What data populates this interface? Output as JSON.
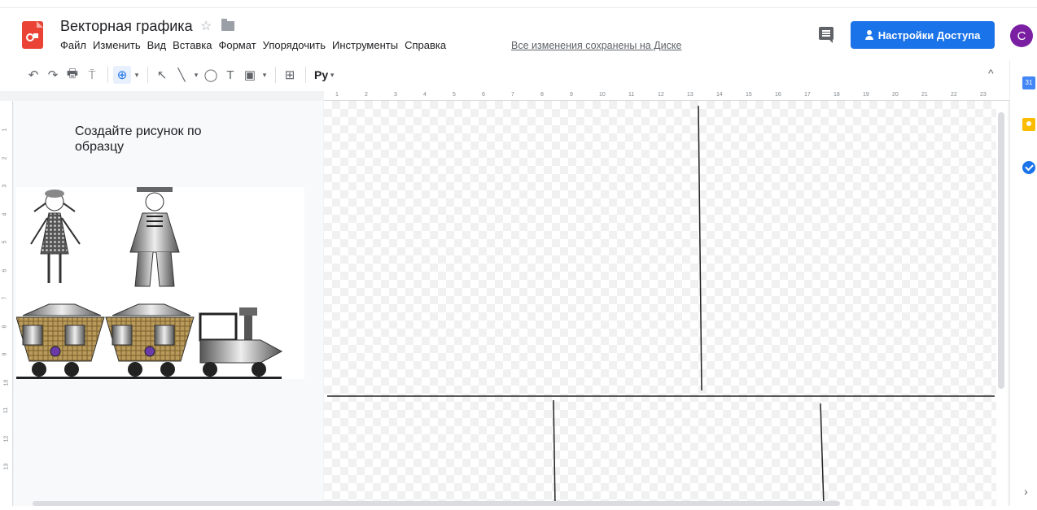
{
  "header": {
    "doc_title": "Векторная графика",
    "star_glyph": "☆",
    "saved_status": "Все изменения сохранены на Диске",
    "share_label": "Настройки Доступа",
    "avatar_letter": "C"
  },
  "menu": [
    "Файл",
    "Изменить",
    "Вид",
    "Вставка",
    "Формат",
    "Упорядочить",
    "Инструменты",
    "Справка"
  ],
  "toolbar": {
    "undo_glyph": "↶",
    "redo_glyph": "↷",
    "print_glyph": "🖶",
    "paint_glyph": "⍑",
    "zoom_glyph": "⊕",
    "dropdown_glyph": "▾",
    "select_glyph": "↖",
    "line_glyph": "╲",
    "shape_glyph": "◯",
    "textbox_glyph": "T",
    "image_glyph": "▣",
    "comment_add_glyph": "⊞",
    "language": "Ру",
    "collapse_glyph": "^"
  },
  "side_panel": {
    "calendar_label": "31",
    "expand_glyph": "›"
  },
  "canvas": {
    "task_text": "Создайте рисунок по образцу"
  },
  "rulers": {
    "top_numbers": [
      "1",
      "2",
      "3",
      "4",
      "5",
      "6",
      "7",
      "8",
      "9",
      "10",
      "11",
      "12",
      "13",
      "14",
      "15",
      "16",
      "17",
      "18",
      "19",
      "20",
      "21",
      "22",
      "23"
    ],
    "left_numbers": [
      "1",
      "2",
      "3",
      "4",
      "5",
      "6",
      "7",
      "8",
      "9",
      "10",
      "11",
      "12",
      "13"
    ]
  },
  "colors": {
    "accent": "#1a73e8",
    "logo": "#ea4335",
    "avatar": "#7b1fa2"
  }
}
